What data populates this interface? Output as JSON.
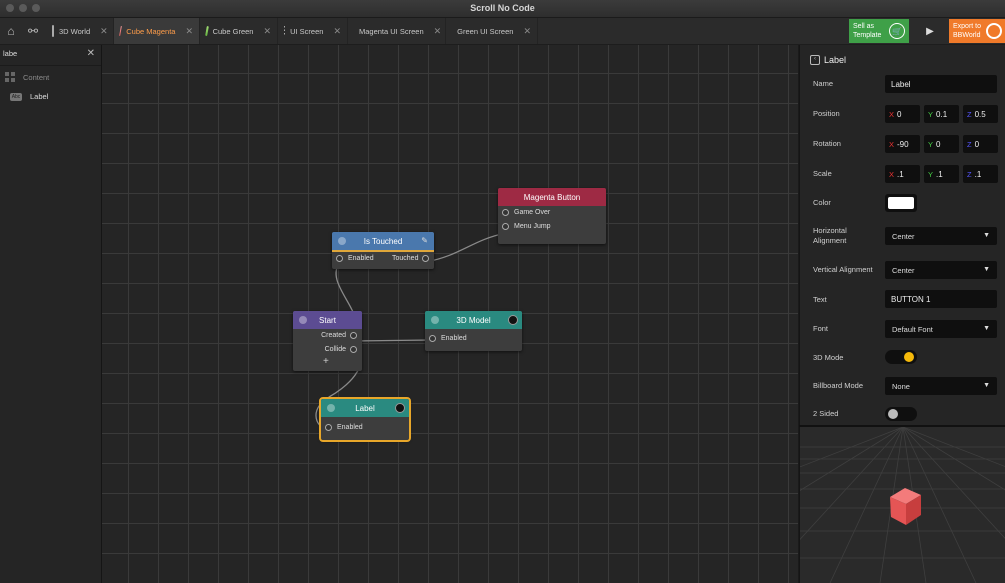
{
  "window": {
    "title": "Scroll No Code"
  },
  "tabs": [
    {
      "label": "3D World",
      "icon": "world-icon",
      "active": false
    },
    {
      "label": "Cube Magenta",
      "icon": "cube-magenta-icon",
      "active": true
    },
    {
      "label": "Cube Green",
      "icon": "cube-green-icon",
      "active": false
    },
    {
      "label": "UI Screen",
      "icon": "ui-screen-icon",
      "active": false
    },
    {
      "label": "Magenta UI Screen",
      "icon": "ui-screen-icon",
      "active": false
    },
    {
      "label": "Green UI Screen",
      "icon": "ui-screen-icon",
      "active": false
    }
  ],
  "toolbar": {
    "sell_line1": "Sell as",
    "sell_line2": "Template",
    "export_line1": "Export to",
    "export_line2": "BBWorld"
  },
  "left_panel": {
    "search_value": "labe",
    "tree": [
      {
        "label": "Content"
      },
      {
        "label": "Label"
      }
    ]
  },
  "nodes": {
    "magenta_button": {
      "title": "Magenta Button",
      "ports": [
        "Game Over",
        "Menu Jump"
      ],
      "color": "#9e2a44"
    },
    "is_touched": {
      "title": "Is Touched",
      "left_port": "Enabled",
      "right_port": "Touched",
      "color": "#4a78ad"
    },
    "start": {
      "title": "Start",
      "ports": [
        "Created",
        "Collide"
      ],
      "color": "#5c4c92"
    },
    "model_3d": {
      "title": "3D Model",
      "port": "Enabled",
      "color": "#2a8a80"
    },
    "label": {
      "title": "Label",
      "port": "Enabled",
      "color": "#2a8a80"
    }
  },
  "inspector": {
    "title": "Label",
    "name_label": "Name",
    "name_value": "Label",
    "position_label": "Position",
    "position": {
      "x": "0",
      "y": "0.1",
      "z": "0.5"
    },
    "rotation_label": "Rotation",
    "rotation": {
      "x": "-90",
      "y": "0",
      "z": "0"
    },
    "scale_label": "Scale",
    "scale": {
      "x": ".1",
      "y": ".1",
      "z": ".1"
    },
    "color_label": "Color",
    "h_align_label_1": "Horizontal",
    "h_align_label_2": "Alignment",
    "h_align_value": "Center",
    "v_align_label": "Vertical Alignment",
    "v_align_value": "Center",
    "text_label": "Text",
    "text_value": "BUTTON 1",
    "font_label": "Font",
    "font_value": "Default Font",
    "mode3d_label": "3D Mode",
    "mode3d_on": true,
    "billboard_label": "Billboard Mode",
    "billboard_value": "None",
    "two_sided_label": "2 Sided",
    "two_sided_on": false
  },
  "colors": {
    "accent": "#ff9d4a",
    "sell": "#3fa048",
    "export": "#f07a2a",
    "toggle_on": "#f5b90a",
    "selection": "#e8a72a"
  }
}
